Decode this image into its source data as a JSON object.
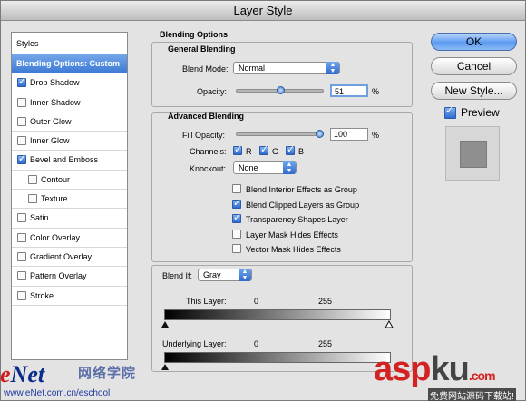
{
  "window": {
    "title": "Layer Style"
  },
  "styles_list": {
    "header": "Styles",
    "items": [
      {
        "label": "Blending Options: Custom",
        "selected": true,
        "checkbox": false
      },
      {
        "label": "Drop Shadow",
        "checked": true,
        "checkbox": true
      },
      {
        "label": "Inner Shadow",
        "checked": false,
        "checkbox": true
      },
      {
        "label": "Outer Glow",
        "checked": false,
        "checkbox": true
      },
      {
        "label": "Inner Glow",
        "checked": false,
        "checkbox": true
      },
      {
        "label": "Bevel and Emboss",
        "checked": true,
        "checkbox": true
      },
      {
        "label": "Contour",
        "checked": false,
        "checkbox": true,
        "sub": true
      },
      {
        "label": "Texture",
        "checked": false,
        "checkbox": true,
        "sub": true
      },
      {
        "label": "Satin",
        "checked": false,
        "checkbox": true
      },
      {
        "label": "Color Overlay",
        "checked": false,
        "checkbox": true
      },
      {
        "label": "Gradient Overlay",
        "checked": false,
        "checkbox": true
      },
      {
        "label": "Pattern Overlay",
        "checked": false,
        "checkbox": true
      },
      {
        "label": "Stroke",
        "checked": false,
        "checkbox": true
      }
    ]
  },
  "blending_options": {
    "title": "Blending Options",
    "general": {
      "title": "General Blending",
      "blend_mode_label": "Blend Mode:",
      "blend_mode_value": "Normal",
      "opacity_label": "Opacity:",
      "opacity_value": "51",
      "opacity_unit": "%",
      "opacity_fraction": 0.51
    },
    "advanced": {
      "title": "Advanced Blending",
      "fill_opacity_label": "Fill Opacity:",
      "fill_opacity_value": "100",
      "fill_opacity_unit": "%",
      "fill_opacity_fraction": 1.0,
      "channels_label": "Channels:",
      "channels": [
        {
          "label": "R",
          "checked": true
        },
        {
          "label": "G",
          "checked": true
        },
        {
          "label": "B",
          "checked": true
        }
      ],
      "knockout_label": "Knockout:",
      "knockout_value": "None",
      "options": [
        {
          "label": "Blend Interior Effects as Group",
          "checked": false
        },
        {
          "label": "Blend Clipped Layers as Group",
          "checked": true
        },
        {
          "label": "Transparency Shapes Layer",
          "checked": true
        },
        {
          "label": "Layer Mask Hides Effects",
          "checked": false
        },
        {
          "label": "Vector Mask Hides Effects",
          "checked": false
        }
      ]
    },
    "blend_if": {
      "label": "Blend If:",
      "value": "Gray",
      "this_layer_label": "This Layer:",
      "this_layer_min": "0",
      "this_layer_max": "255",
      "underlying_label": "Underlying Layer:",
      "underlying_min": "0",
      "underlying_max": "255"
    }
  },
  "buttons": {
    "ok": "OK",
    "cancel": "Cancel",
    "new_style": "New Style...",
    "preview_label": "Preview",
    "preview_checked": true
  },
  "watermarks": {
    "enet_prefix": "e",
    "enet_rest": "Net",
    "enet_cn": "网络学院",
    "enet_url": "www.eNet.com.cn/eschool",
    "aspku_main": "asp",
    "aspku_ku": "ku",
    "aspku_dotcom": ".com",
    "aspku_sub": "免费网站源码下载站!"
  },
  "colors": {
    "accent": "#3e7bd6",
    "window_bg": "#e3e3e3",
    "watermark_red": "#d42222",
    "watermark_blue": "#0a2c8a"
  }
}
